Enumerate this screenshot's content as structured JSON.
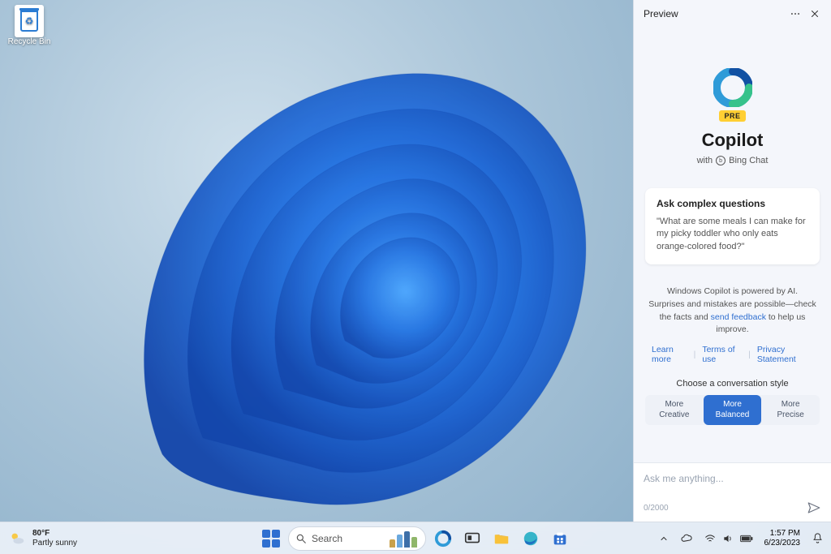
{
  "desktop": {
    "recycle_bin_label": "Recycle Bin"
  },
  "copilot": {
    "header_title": "Preview",
    "pre_badge": "PRE",
    "title": "Copilot",
    "with_prefix": "with",
    "with_service": "Bing Chat",
    "card_title": "Ask complex questions",
    "card_example": "\"What are some meals I can make for my picky toddler who only eats orange-colored food?\"",
    "disclaimer_pre": "Windows Copilot is powered by AI. Surprises and mistakes are possible—check the facts and ",
    "disclaimer_link": "send feedback",
    "disclaimer_post": " to help us improve.",
    "links": [
      "Learn more",
      "Terms of use",
      "Privacy Statement"
    ],
    "style_title": "Choose a conversation style",
    "styles": [
      {
        "line1": "More",
        "line2": "Creative",
        "active": false
      },
      {
        "line1": "More",
        "line2": "Balanced",
        "active": true
      },
      {
        "line1": "More",
        "line2": "Precise",
        "active": false
      }
    ],
    "input_placeholder": "Ask me anything...",
    "char_counter": "0/2000"
  },
  "taskbar": {
    "weather_temp": "80°F",
    "weather_cond": "Partly sunny",
    "search_placeholder": "Search",
    "clock_time": "1:57 PM",
    "clock_date": "6/23/2023"
  }
}
